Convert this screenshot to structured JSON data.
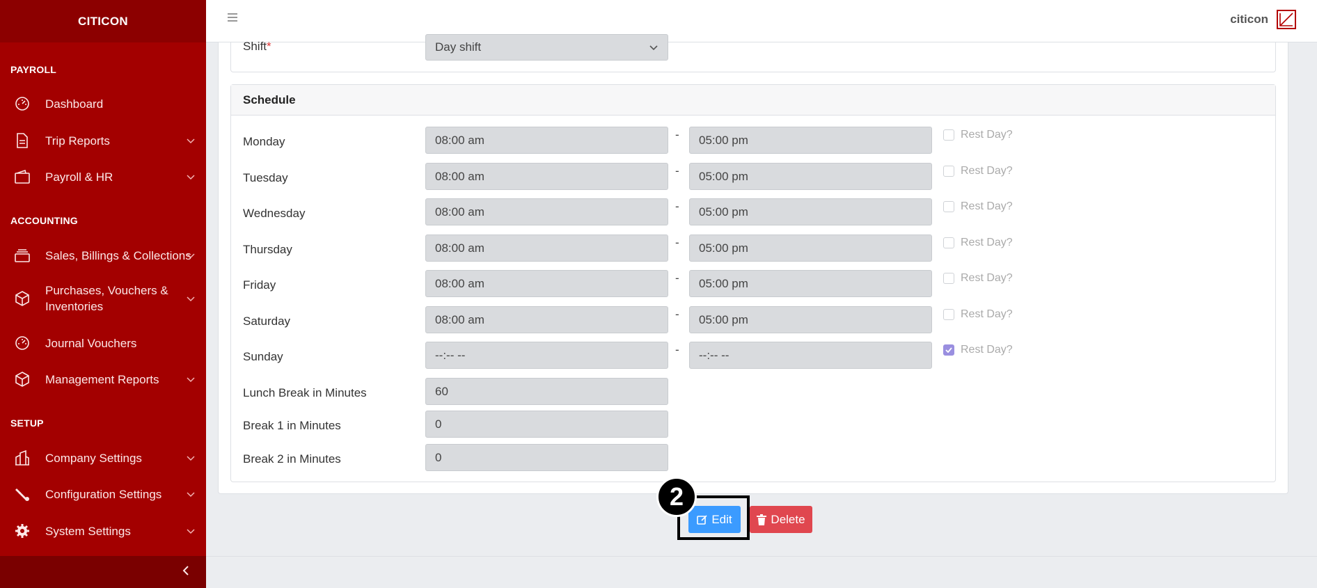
{
  "sidebar": {
    "brand": "CITICON",
    "sections": {
      "payroll": "PAYROLL",
      "accounting": "ACCOUNTING",
      "setup": "SETUP"
    },
    "items": [
      {
        "label": "Dashboard",
        "icon": "gauge-icon",
        "has_children": false
      },
      {
        "label": "Trip Reports",
        "icon": "document-icon",
        "has_children": true
      },
      {
        "label": "Payroll & HR",
        "icon": "wallet-icon",
        "has_children": true
      },
      {
        "label": "Sales, Billings & Collections",
        "icon": "layers-icon",
        "has_children": true
      },
      {
        "label": "Purchases, Vouchers & Inventories",
        "icon": "box-icon",
        "has_children": true
      },
      {
        "label": "Journal Vouchers",
        "icon": "gauge-icon",
        "has_children": false
      },
      {
        "label": "Management Reports",
        "icon": "box-icon",
        "has_children": true
      },
      {
        "label": "Company Settings",
        "icon": "building-icon",
        "has_children": true
      },
      {
        "label": "Configuration Settings",
        "icon": "wrench-icon",
        "has_children": true
      },
      {
        "label": "System Settings",
        "icon": "gear-icon",
        "has_children": true
      }
    ]
  },
  "topbar": {
    "user_name": "citicon"
  },
  "form": {
    "shift_label": "Shift",
    "shift_required": "*",
    "shift_value": "Day shift",
    "schedule_title": "Schedule",
    "rest_day_label": "Rest Day?",
    "days": [
      {
        "day": "Monday",
        "start": "08:00 am",
        "end": "05:00 pm",
        "rest": false
      },
      {
        "day": "Tuesday",
        "start": "08:00 am",
        "end": "05:00 pm",
        "rest": false
      },
      {
        "day": "Wednesday",
        "start": "08:00 am",
        "end": "05:00 pm",
        "rest": false
      },
      {
        "day": "Thursday",
        "start": "08:00 am",
        "end": "05:00 pm",
        "rest": false
      },
      {
        "day": "Friday",
        "start": "08:00 am",
        "end": "05:00 pm",
        "rest": false
      },
      {
        "day": "Saturday",
        "start": "08:00 am",
        "end": "05:00 pm",
        "rest": false
      },
      {
        "day": "Sunday",
        "start": "--:-- --",
        "end": "--:-- --",
        "rest": true
      }
    ],
    "dash": "-",
    "lunch_break_label": "Lunch Break in Minutes",
    "lunch_break_value": "60",
    "break1_label": "Break 1 in Minutes",
    "break1_value": "0",
    "break2_label": "Break 2 in Minutes",
    "break2_value": "0"
  },
  "actions": {
    "edit_label": "Edit",
    "delete_label": "Delete"
  },
  "annotation": {
    "step_number": "2"
  },
  "colors": {
    "sidebar_bg": "#a30000",
    "brand_bg": "#8c0000",
    "edit_button": "#3b9bff",
    "delete_button": "#e0474f",
    "checked": "#9a8fe0"
  }
}
